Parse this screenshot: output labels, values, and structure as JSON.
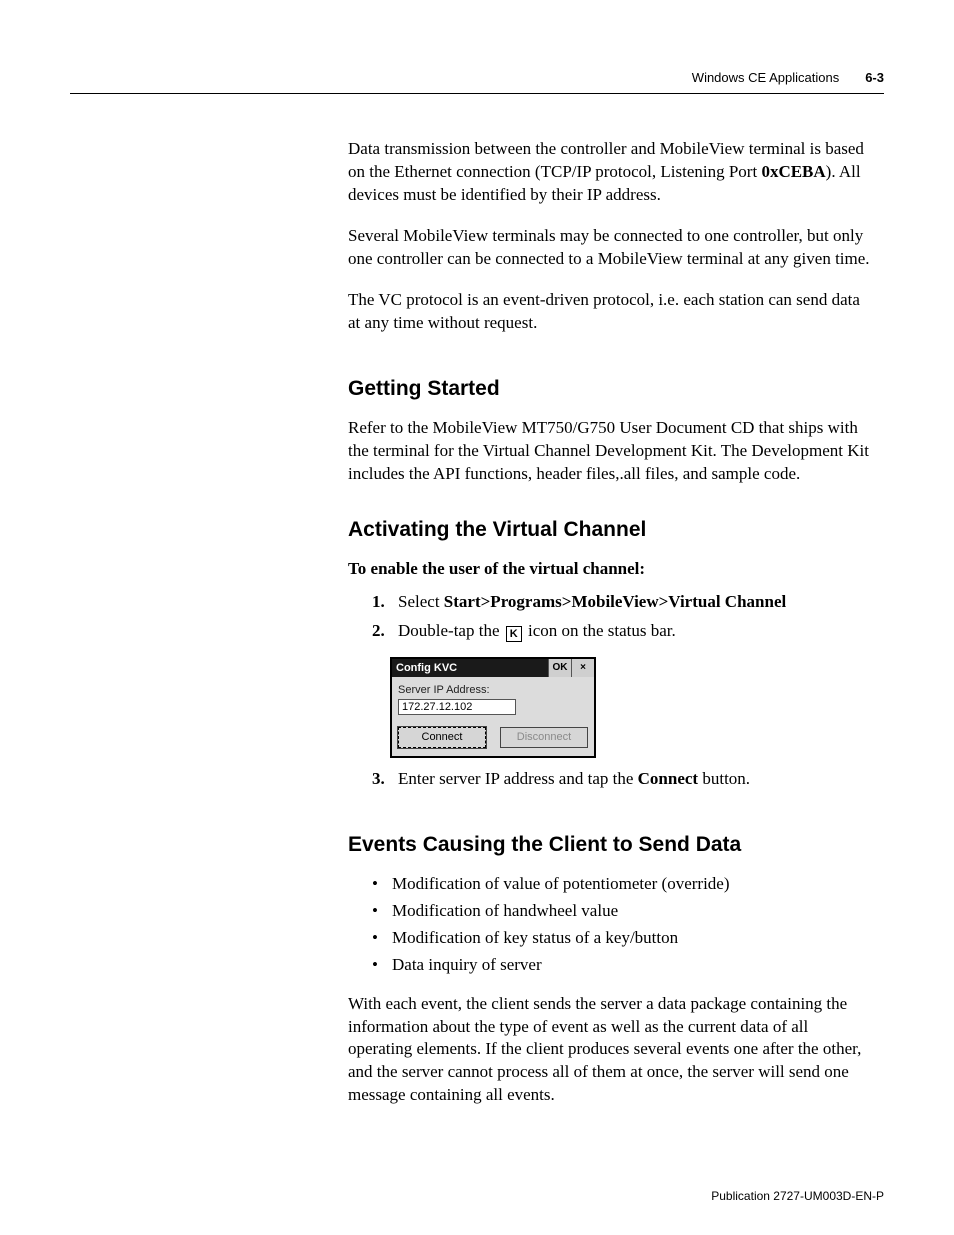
{
  "header": {
    "section_title": "Windows CE Applications",
    "page_number": "6-3"
  },
  "intro": {
    "p1_a": "Data transmission between the controller and MobileView terminal is based on the Ethernet connection (TCP/IP protocol, Listening Port ",
    "port_bold": "0xCEBA",
    "p1_b": "). All devices must be identified by their IP address.",
    "p2": "Several MobileView terminals may be connected to one controller, but only one controller can be connected to a MobileView terminal at any given time.",
    "p3": "The VC protocol is an event-driven protocol, i.e. each station can send data at any time without request."
  },
  "getting_started": {
    "heading": "Getting Started",
    "p1": "Refer to the MobileView MT750/G750 User Document CD that ships with the terminal for the Virtual Channel Development Kit. The Development Kit includes the API functions, header files,.all files, and sample code."
  },
  "activating": {
    "heading": "Activating the Virtual Channel",
    "instruction_head": "To enable the user of the virtual channel:",
    "step1_lead": "Select ",
    "step1_path": "Start>Programs>MobileView>Virtual Channel",
    "step2_a": "Double-tap the ",
    "step2_icon_letter": "K",
    "step2_b": " icon on the status bar.",
    "step3_a": "Enter server IP address and tap the ",
    "step3_bold": "Connect",
    "step3_b": " button."
  },
  "dialog": {
    "title": "Config KVC",
    "ok_label": "OK",
    "close_label": "×",
    "ip_label": "Server IP Address:",
    "ip_value": "172.27.12.102",
    "connect_label": "Connect",
    "disconnect_label": "Disconnect"
  },
  "events": {
    "heading": "Events Causing the Client to Send Data",
    "items": [
      "Modification of value of potentiometer (override)",
      "Modification of handwheel value",
      "Modification of key status of a key/button",
      "Data inquiry of server"
    ],
    "closing": "With each event, the client sends the server a data package containing the information about the type of event as well as the current data of all operating elements. If the client produces several events one after the other, and the server cannot process all of them at once, the server will send one message containing all events."
  },
  "footer": {
    "publication": "Publication 2727-UM003D-EN-P"
  },
  "numbers": {
    "n1": "1.",
    "n2": "2.",
    "n3": "3."
  },
  "bullet": "•"
}
